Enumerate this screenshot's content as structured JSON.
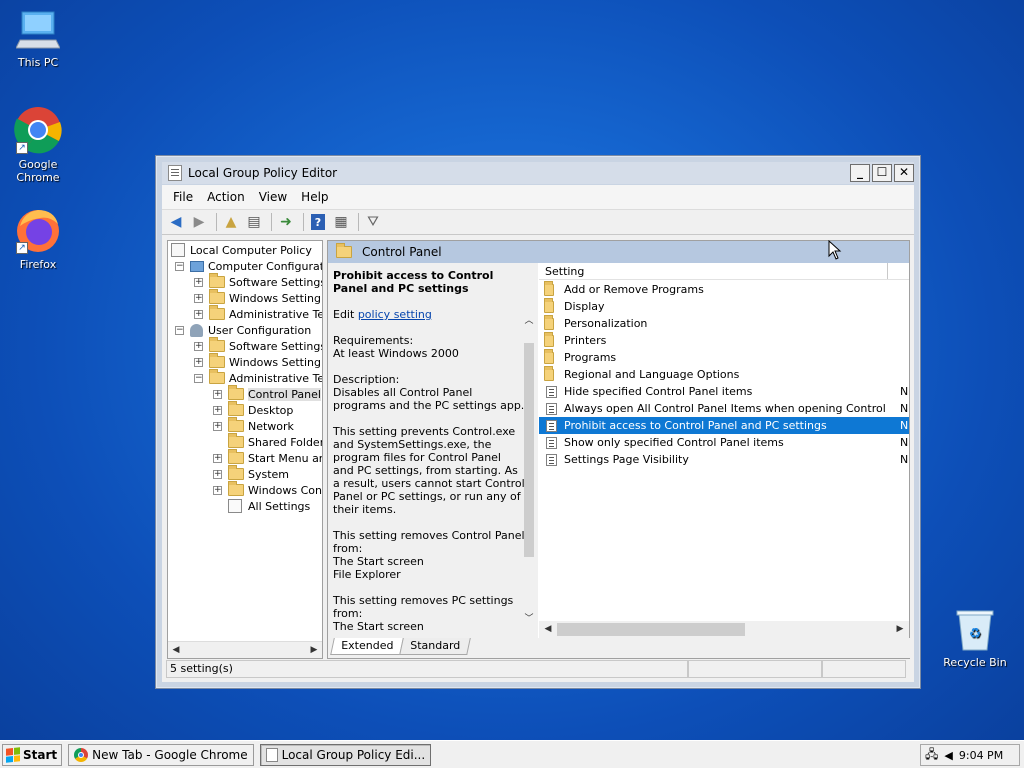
{
  "desktop": {
    "icons": [
      {
        "label": "This PC"
      },
      {
        "label": "Google Chrome"
      },
      {
        "label": "Firefox"
      },
      {
        "label": "Recycle Bin"
      }
    ]
  },
  "window": {
    "title": "Local Group Policy Editor",
    "controls": {
      "minimize": "_",
      "maximize": "☐",
      "close": "✕"
    },
    "menu": [
      "File",
      "Action",
      "View",
      "Help"
    ],
    "tree": [
      {
        "label": "Local Computer Policy",
        "expander": ""
      },
      {
        "label": "Computer Configurat",
        "expander": "−"
      },
      {
        "label": "Software Settings",
        "expander": "+"
      },
      {
        "label": "Windows Setting",
        "expander": "+"
      },
      {
        "label": "Administrative Ter",
        "expander": "+"
      },
      {
        "label": "User Configuration",
        "expander": "−"
      },
      {
        "label": "Software Settings",
        "expander": "+"
      },
      {
        "label": "Windows Setting",
        "expander": "+"
      },
      {
        "label": "Administrative Ter",
        "expander": "−"
      },
      {
        "label": "Control Panel",
        "expander": "+"
      },
      {
        "label": "Desktop",
        "expander": "+"
      },
      {
        "label": "Network",
        "expander": "+"
      },
      {
        "label": "Shared Folder",
        "expander": ""
      },
      {
        "label": "Start Menu ar",
        "expander": "+"
      },
      {
        "label": "System",
        "expander": "+"
      },
      {
        "label": "Windows Con",
        "expander": "+"
      },
      {
        "label": "All Settings",
        "expander": ""
      }
    ],
    "panel": {
      "header": "Control Panel",
      "description": {
        "title": "Prohibit access to Control Panel and PC settings",
        "edit_prefix": "Edit ",
        "edit_link": "policy setting",
        "requirements_label": "Requirements:",
        "requirements_value": "At least Windows 2000",
        "description_label": "Description:",
        "description_p1": "Disables all Control Panel programs and the PC settings app.",
        "description_p2": "This setting prevents Control.exe and SystemSettings.exe, the program files for Control Panel and PC settings, from starting. As a result, users cannot start Control Panel or PC settings, or run any of their items.",
        "removes_cp": "This setting removes Control Panel from:",
        "removes_cp_1": "The Start screen",
        "removes_cp_2": "File Explorer",
        "removes_pc": "This setting removes PC settings from:",
        "removes_pc_1": "The Start screen"
      },
      "list_header": "Setting",
      "items": [
        {
          "name": "Add or Remove Programs",
          "type": "folder",
          "state": ""
        },
        {
          "name": "Display",
          "type": "folder",
          "state": ""
        },
        {
          "name": "Personalization",
          "type": "folder",
          "state": ""
        },
        {
          "name": "Printers",
          "type": "folder",
          "state": ""
        },
        {
          "name": "Programs",
          "type": "folder",
          "state": ""
        },
        {
          "name": "Regional and Language Options",
          "type": "folder",
          "state": ""
        },
        {
          "name": "Hide specified Control Panel items",
          "type": "setting",
          "state": "N"
        },
        {
          "name": "Always open All Control Panel Items when opening Control P...",
          "type": "setting",
          "state": "N"
        },
        {
          "name": "Prohibit access to Control Panel and PC settings",
          "type": "setting",
          "state": "N",
          "selected": true
        },
        {
          "name": "Show only specified Control Panel items",
          "type": "setting",
          "state": "N"
        },
        {
          "name": "Settings Page Visibility",
          "type": "setting",
          "state": "N"
        }
      ],
      "tabs": [
        "Extended",
        "Standard"
      ]
    },
    "status": "5 setting(s)"
  },
  "taskbar": {
    "start_label": "Start",
    "tasks": [
      {
        "label": "New Tab - Google Chrome"
      },
      {
        "label": "Local Group Policy Edi..."
      }
    ],
    "clock": "9:04 PM"
  }
}
